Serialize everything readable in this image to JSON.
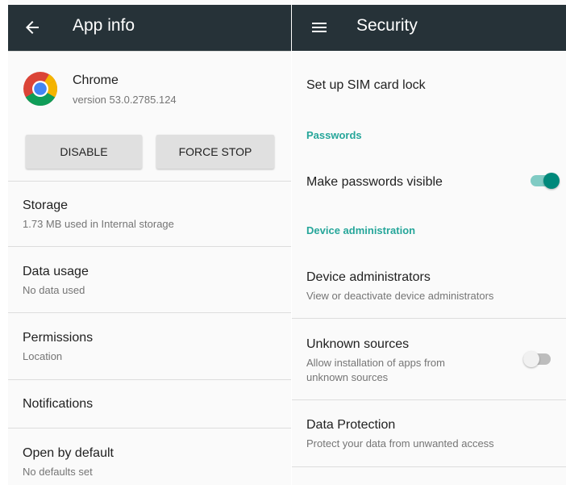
{
  "left": {
    "header": {
      "title": "App info",
      "back_icon": "arrow-back-icon"
    },
    "app": {
      "name": "Chrome",
      "version": "version 53.0.2785.124",
      "icon": "chrome-icon"
    },
    "buttons": {
      "disable": "Disable",
      "force_stop": "Force stop"
    },
    "items": [
      {
        "title": "Storage",
        "subtitle": "1.73 MB used in Internal storage"
      },
      {
        "title": "Data usage",
        "subtitle": "No data used"
      },
      {
        "title": "Permissions",
        "subtitle": "Location"
      },
      {
        "title": "Notifications",
        "subtitle": ""
      },
      {
        "title": "Open by default",
        "subtitle": "No defaults set"
      }
    ]
  },
  "right": {
    "header": {
      "title": "Security",
      "menu_icon": "hamburger-menu-icon"
    },
    "sim_lock": "Set up SIM card lock",
    "passwords_header": "Passwords",
    "make_passwords_visible": {
      "label": "Make passwords visible",
      "checked": true
    },
    "device_admin_header": "Device administration",
    "device_administrators": {
      "title": "Device administrators",
      "subtitle": "View or deactivate device administrators"
    },
    "unknown_sources": {
      "title": "Unknown sources",
      "subtitle_line1": "Allow installation of apps from",
      "subtitle_line2": "unknown sources",
      "checked": false
    },
    "data_protection": {
      "title": "Data Protection",
      "subtitle": "Protect your data from unwanted access"
    }
  },
  "colors": {
    "toolbar": "#263238",
    "accent": "#00897b",
    "accent_track": "#80cbc4",
    "header_text": "#26a69a"
  }
}
